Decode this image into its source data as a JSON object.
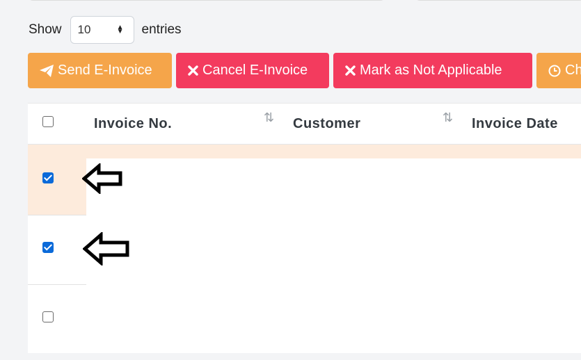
{
  "length_menu": {
    "show_label": "Show",
    "selected_value": "10",
    "entries_label": "entries"
  },
  "actions": {
    "send": "Send E-Invoice",
    "cancel": "Cancel E-Invoice",
    "mark": "Mark as Not Applicable",
    "partial": "Ch"
  },
  "table": {
    "headers": [
      "Invoice No.",
      "Customer",
      "Invoice Date"
    ],
    "rows": [
      {
        "checked": true
      },
      {
        "checked": true
      },
      {
        "checked": false
      }
    ]
  },
  "colors": {
    "orange_button": "#f5a54a",
    "red_button": "#f33b5e",
    "checkbox_checked": "#0b6ad9",
    "selected_row": "#fdebdc"
  }
}
